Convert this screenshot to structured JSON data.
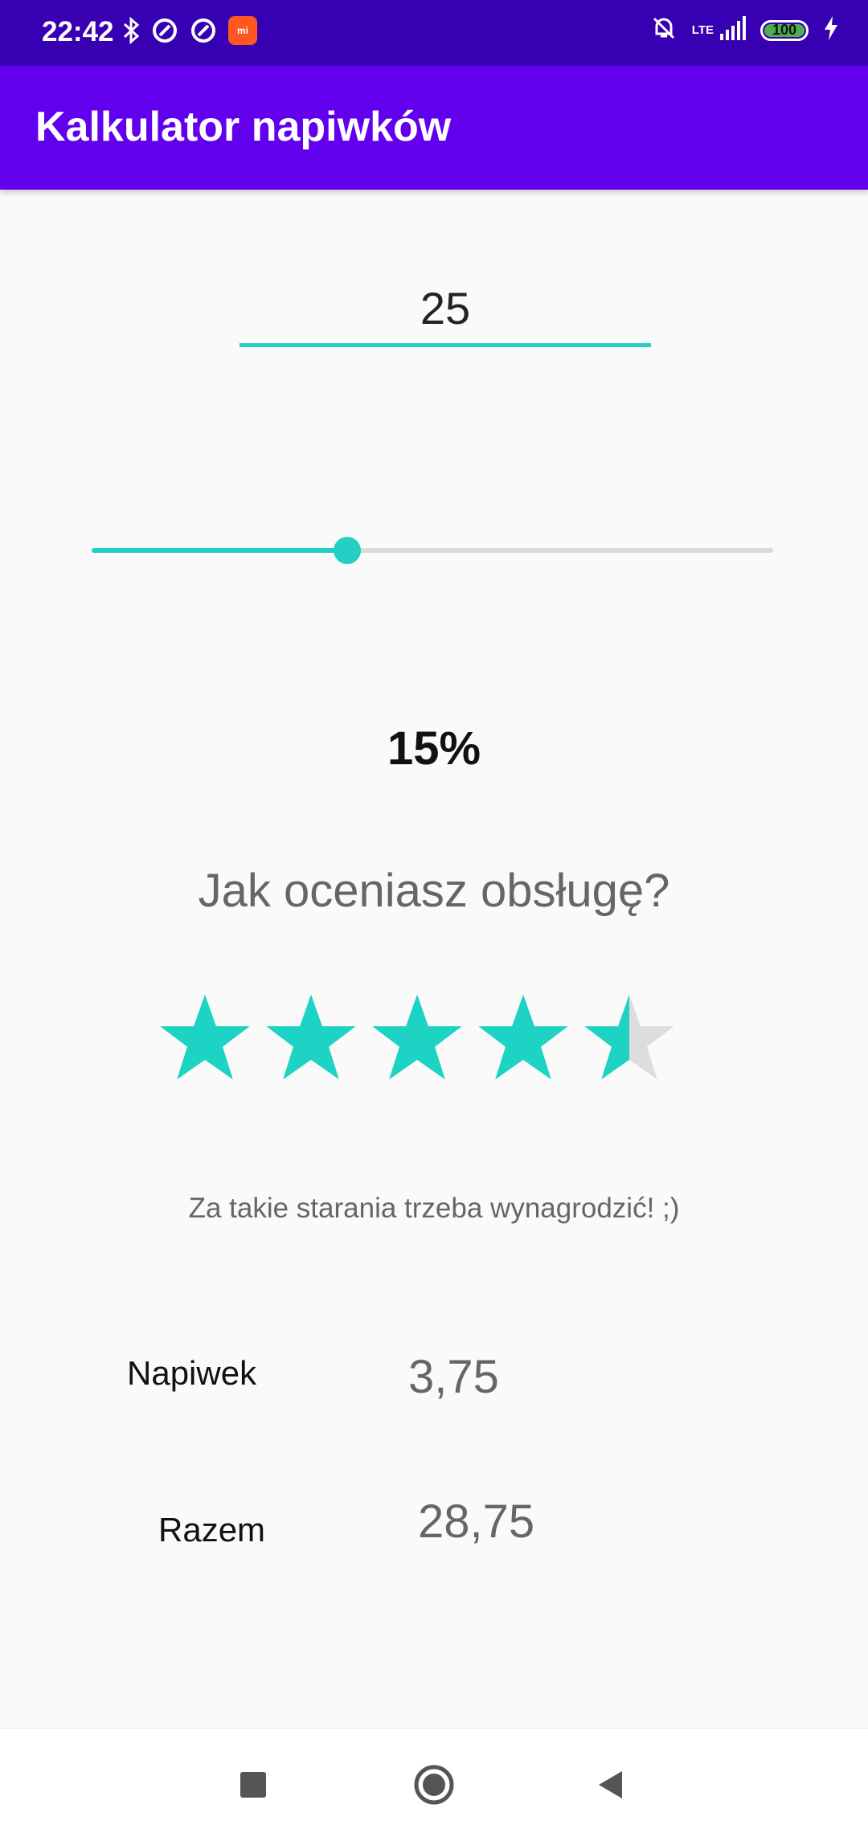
{
  "status_bar": {
    "time": "22:42",
    "network": "LTE",
    "battery": "100",
    "left_icons": [
      "bluetooth-icon",
      "data-saver-icon",
      "data-saver-icon",
      "mi-app-icon"
    ],
    "right_icons": [
      "alarm-off-icon",
      "signal-icon",
      "battery-icon",
      "charging-icon"
    ]
  },
  "app_bar": {
    "title": "Kalkulator napiwków"
  },
  "bill": {
    "value": "25"
  },
  "tip_slider": {
    "value_percent": 15,
    "max_percent": 40
  },
  "tip_percent_label": "15%",
  "rating": {
    "question": "Jak oceniasz obsługę?",
    "value": 4.5,
    "max": 5,
    "note": "Za takie starania trzeba wynagrodzić! ;)"
  },
  "results": {
    "tip_label": "Napiwek",
    "tip_value": "3,75",
    "total_label": "Razem",
    "total_value": "28,75"
  },
  "colors": {
    "status_bar": "#3700b3",
    "app_bar": "#6200ee",
    "accent": "#26cfc4",
    "star_filled": "#1dd3c4",
    "star_empty": "#dddddd"
  },
  "nav_bar": {
    "icons": [
      "recent-apps-icon",
      "home-icon",
      "back-icon"
    ]
  }
}
